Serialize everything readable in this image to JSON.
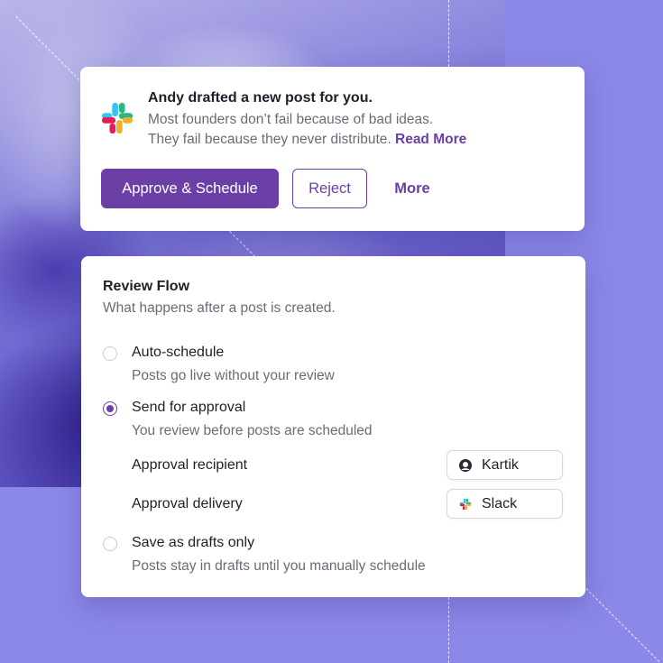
{
  "notification": {
    "icon": "slack-logo",
    "title": "Andy drafted a new post for you.",
    "body_line1": "Most founders don’t fail because of bad ideas.",
    "body_line2": "They fail because they never distribute.",
    "read_more": "Read More",
    "approve_label": "Approve & Schedule",
    "reject_label": "Reject",
    "more_label": "More"
  },
  "review": {
    "title": "Review Flow",
    "subtitle": "What happens after a post is created.",
    "options": [
      {
        "label": "Auto-schedule",
        "description": "Posts go live without your review",
        "selected": false
      },
      {
        "label": "Send for approval",
        "description": "You review before posts are scheduled",
        "selected": true
      },
      {
        "label": "Save as drafts only",
        "description": "Posts stay in drafts until you manually schedule",
        "selected": false
      }
    ],
    "recipient": {
      "label": "Approval recipient",
      "value": "Kartik",
      "icon": "user-avatar-icon"
    },
    "delivery": {
      "label": "Approval delivery",
      "value": "Slack",
      "icon": "slack-icon"
    }
  },
  "colors": {
    "accent": "#6b3fa6",
    "background": "#8c88e8"
  }
}
